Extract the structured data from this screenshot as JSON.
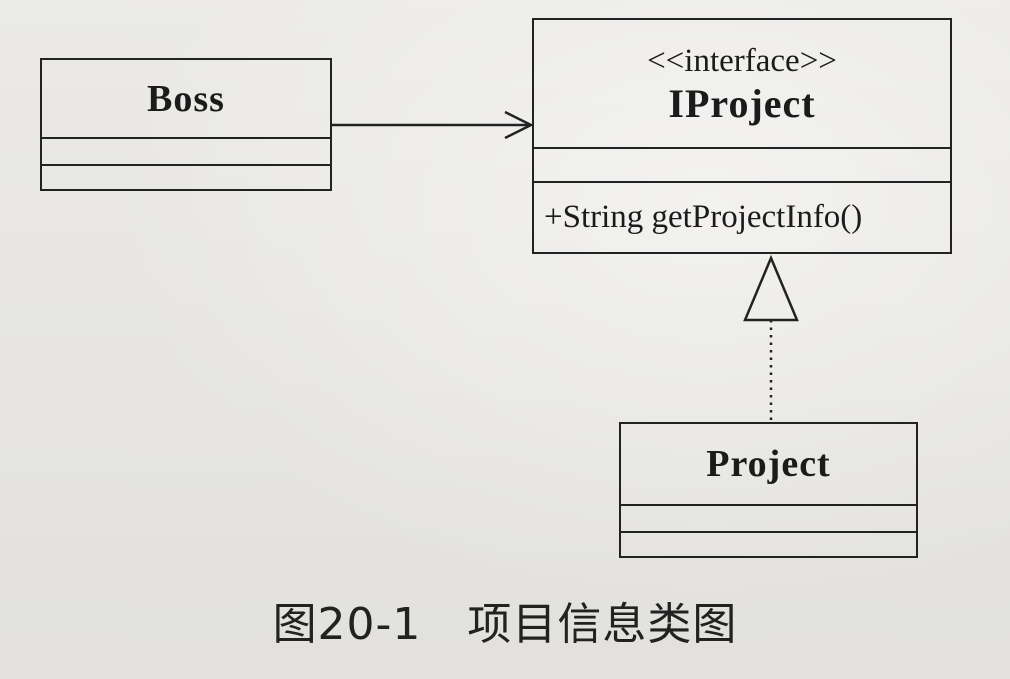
{
  "diagram": {
    "classes": {
      "boss": {
        "name": "Boss"
      },
      "iproject": {
        "stereotype": "<<interface>>",
        "name": "IProject",
        "operations": [
          "+String getProjectInfo()"
        ]
      },
      "project": {
        "name": "Project"
      }
    },
    "relations": [
      {
        "from": "Boss",
        "to": "IProject",
        "kind": "dependency/association (open arrow)"
      },
      {
        "from": "Project",
        "to": "IProject",
        "kind": "realization (dotted line, hollow triangle)"
      }
    ]
  },
  "caption": {
    "figure_number": "图20-1",
    "title": "项目信息类图"
  },
  "colors": {
    "background": "#e9e8e4",
    "ink": "#1b1b1b"
  }
}
